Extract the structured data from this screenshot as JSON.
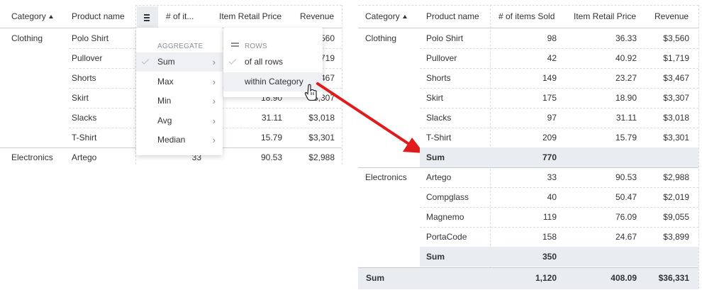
{
  "colors": {
    "accent_arrow": "#e01b1b",
    "sum_band": "#e9edf2",
    "grid": "#d9dde3"
  },
  "left": {
    "headers": {
      "category": "Category",
      "product": "Product name",
      "items": "# of it...",
      "price": "Item Retail Price",
      "revenue": "Revenue"
    },
    "menu_button_icon": "hamburger-icon",
    "rows": [
      {
        "category": "Clothing",
        "product": "Polo Shirt",
        "revenue": "560"
      },
      {
        "category": "",
        "product": "Pullover",
        "revenue": "719"
      },
      {
        "category": "",
        "product": "Shorts",
        "revenue": "467"
      },
      {
        "category": "",
        "product": "Skirt",
        "price": "18.90",
        "revenue": "3,307"
      },
      {
        "category": "",
        "product": "Slacks",
        "price": "31.11",
        "revenue": "$3,018"
      },
      {
        "category": "",
        "product": "T-Shirt",
        "price": "15.79",
        "revenue": "$3,301"
      },
      {
        "category": "Electronics",
        "product": "Artego",
        "items": "33",
        "price": "90.53",
        "revenue": "$2,988"
      }
    ],
    "aggregate_menu": {
      "heading": "AGGREGATE",
      "items": [
        "Sum",
        "Max",
        "Min",
        "Avg",
        "Median"
      ],
      "selected": "Sum"
    },
    "rows_menu": {
      "heading": "ROWS",
      "items": [
        "of all rows",
        "within Category"
      ],
      "checked": "of all rows",
      "hovered": "within Category"
    }
  },
  "right": {
    "headers": {
      "category": "Category",
      "product": "Product name",
      "items": "# of items Sold",
      "price": "Item Retail Price",
      "revenue": "Revenue"
    },
    "rows": [
      {
        "category": "Clothing",
        "product": "Polo Shirt",
        "items": "98",
        "price": "36.33",
        "revenue": "$3,560"
      },
      {
        "category": "",
        "product": "Pullover",
        "items": "42",
        "price": "40.92",
        "revenue": "$1,719"
      },
      {
        "category": "",
        "product": "Shorts",
        "items": "149",
        "price": "23.27",
        "revenue": "$3,467"
      },
      {
        "category": "",
        "product": "Skirt",
        "items": "175",
        "price": "18.90",
        "revenue": "$3,307"
      },
      {
        "category": "",
        "product": "Slacks",
        "items": "97",
        "price": "31.11",
        "revenue": "$3,018"
      },
      {
        "category": "",
        "product": "T-Shirt",
        "items": "209",
        "price": "15.79",
        "revenue": "$3,301"
      },
      {
        "category": "",
        "product": "Sum",
        "items": "770",
        "price": "",
        "revenue": "",
        "is_sum": true
      },
      {
        "category": "Electronics",
        "product": "Artego",
        "items": "33",
        "price": "90.53",
        "revenue": "$2,988"
      },
      {
        "category": "",
        "product": "Compglass",
        "items": "40",
        "price": "50.47",
        "revenue": "$2,019"
      },
      {
        "category": "",
        "product": "Magnemo",
        "items": "119",
        "price": "76.09",
        "revenue": "$9,055"
      },
      {
        "category": "",
        "product": "PortaCode",
        "items": "158",
        "price": "24.67",
        "revenue": "$3,899"
      },
      {
        "category": "",
        "product": "Sum",
        "items": "350",
        "price": "",
        "revenue": "",
        "is_sum": true
      }
    ],
    "grand_total": {
      "label": "Sum",
      "items": "1,120",
      "price": "408.09",
      "revenue": "$36,331"
    }
  }
}
